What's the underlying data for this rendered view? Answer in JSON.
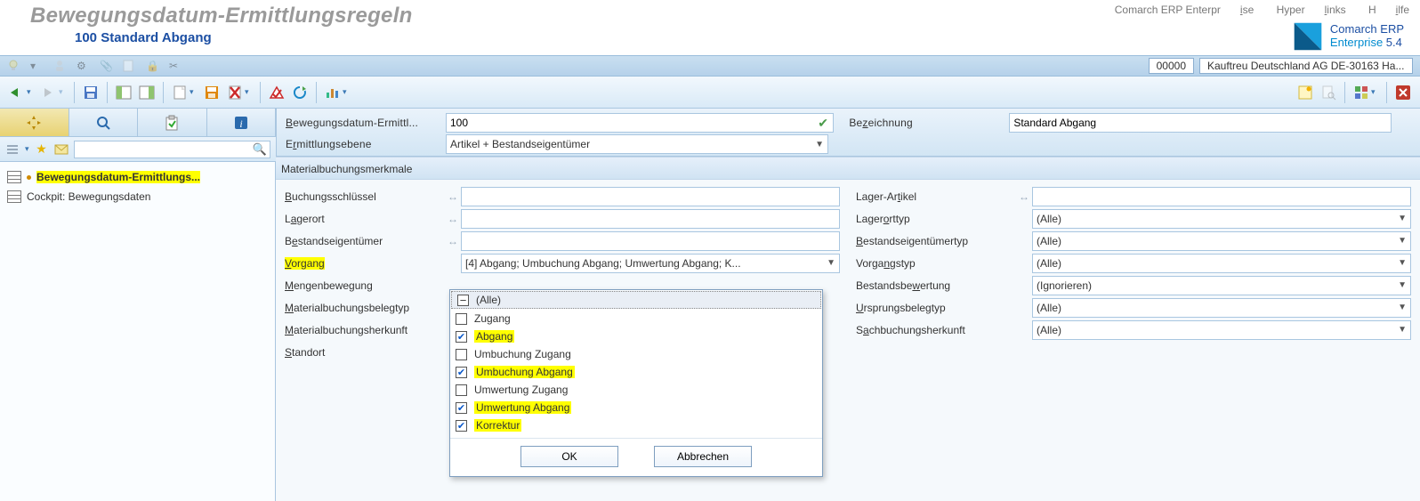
{
  "app": {
    "title": "Bewegungsdatum-Ermittlungsregeln",
    "subtitle": "100 Standard Abgang"
  },
  "topmenu": {
    "item1": "Comarch ERP Enterprise",
    "item2": "Hyperlinks",
    "item3": "Hilfe"
  },
  "brand": {
    "line1": "Comarch ERP",
    "line2": "Enterprise",
    "ver": "5.4"
  },
  "status": {
    "code": "00000",
    "text": "Kauftreu Deutschland AG  DE-30163 Ha..."
  },
  "header": {
    "id_label": "Bewegungsdatum-Ermittl...",
    "id_value": "100",
    "bez_label": "Bezeichnung",
    "bez_value": "Standard Abgang",
    "ebene_label": "Ermittlungsebene",
    "ebene_value": "Artikel + Bestandseigentümer"
  },
  "nav": {
    "item1": "Bewegungsdatum-Ermittlungs...",
    "item2": "Cockpit: Bewegungsdaten"
  },
  "section": {
    "title": "Materialbuchungsmerkmale"
  },
  "left": {
    "buchschl": "Buchungsschlüssel",
    "lagerort": "Lagerort",
    "bestand": "Bestandseigentümer",
    "vorgang": "Vorgang",
    "vorgang_val": "[4] Abgang; Umbuchung Abgang; Umwertung Abgang; K...",
    "menge": "Mengenbewegung",
    "mbtyp": "Materialbuchungsbelegtyp",
    "mbherk": "Materialbuchungsherkunft",
    "standort": "Standort"
  },
  "right": {
    "lagerart": "Lager-Artikel",
    "lagerorttyp": "Lagerorttyp",
    "lagerorttyp_v": "(Alle)",
    "betyp": "Bestandseigentümertyp",
    "betyp_v": "(Alle)",
    "vgtyp": "Vorgangstyp",
    "vgtyp_v": "(Alle)",
    "bewert": "Bestandsbewertung",
    "bewert_v": "(Ignorieren)",
    "ubtyp": "Ursprungsbelegtyp",
    "ubtyp_v": "(Alle)",
    "sbherk": "Sachbuchungsherkunft",
    "sbherk_v": "(Alle)"
  },
  "dropdown": {
    "alle": "(Alle)",
    "opt1": "Zugang",
    "opt2": "Abgang",
    "opt3": "Umbuchung Zugang",
    "opt4": "Umbuchung Abgang",
    "opt5": "Umwertung Zugang",
    "opt6": "Umwertung Abgang",
    "opt7": "Korrektur",
    "ok": "OK",
    "cancel": "Abbrechen"
  }
}
